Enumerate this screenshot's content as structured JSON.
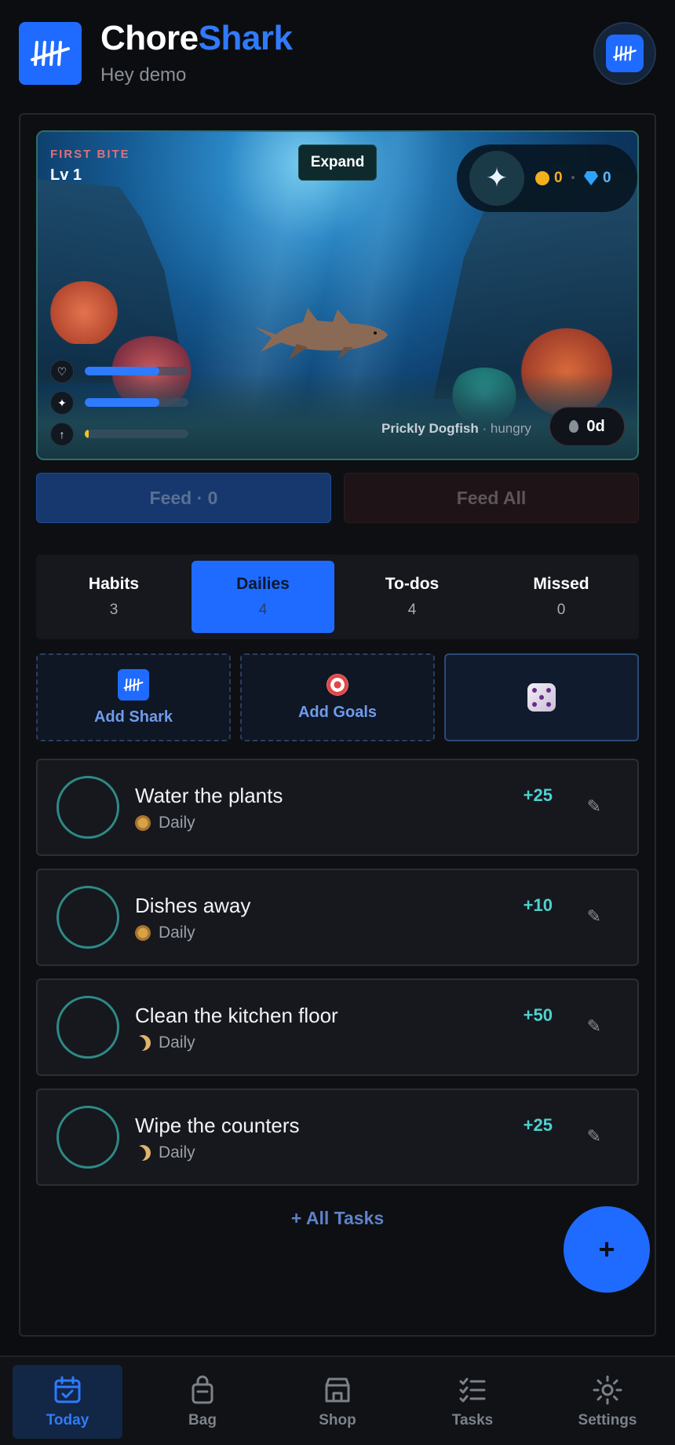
{
  "app": {
    "brand_part1": "Chore",
    "brand_part2": "Shark",
    "greeting": "Hey demo"
  },
  "scene": {
    "badge": "FIRST BITE",
    "level": "Lv 1",
    "expand_label": "Expand",
    "coins": "0",
    "gems": "0",
    "shark_name": "Prickly Dogfish",
    "shark_status": " · hungry",
    "days": "0d",
    "health_level": 0.72,
    "energy_level": 0.72,
    "xp_level": 0.04
  },
  "feed": {
    "feed_label": "Feed · 0",
    "feed_all_label": "Feed All"
  },
  "tabs": [
    {
      "label": "Habits",
      "count": "3"
    },
    {
      "label": "Dailies",
      "count": "4"
    },
    {
      "label": "To-dos",
      "count": "4"
    },
    {
      "label": "Missed",
      "count": "0"
    }
  ],
  "quick_actions": {
    "add_shark": "Add Shark",
    "add_goals": "Add Goals"
  },
  "tasks": [
    {
      "title": "Water the plants",
      "frequency": "Daily",
      "points": "+25",
      "time_icon": "sun-icon"
    },
    {
      "title": "Dishes away",
      "frequency": "Daily",
      "points": "+10",
      "time_icon": "sun-icon"
    },
    {
      "title": "Clean the kitchen floor",
      "frequency": "Daily",
      "points": "+50",
      "time_icon": "moon-icon"
    },
    {
      "title": "Wipe the counters",
      "frequency": "Daily",
      "points": "+25",
      "time_icon": "moon-icon"
    }
  ],
  "all_tasks_label": "+ All Tasks",
  "fab_label": "+",
  "nav": [
    {
      "label": "Today",
      "icon": "calendar-icon"
    },
    {
      "label": "Bag",
      "icon": "bag-icon"
    },
    {
      "label": "Shop",
      "icon": "store-icon"
    },
    {
      "label": "Tasks",
      "icon": "checklist-icon"
    },
    {
      "label": "Settings",
      "icon": "gear-icon"
    }
  ],
  "colors": {
    "accent": "#1f6bff",
    "points": "#4fd1d1",
    "coin": "#f2b01e",
    "gem": "#2fa2ff"
  }
}
